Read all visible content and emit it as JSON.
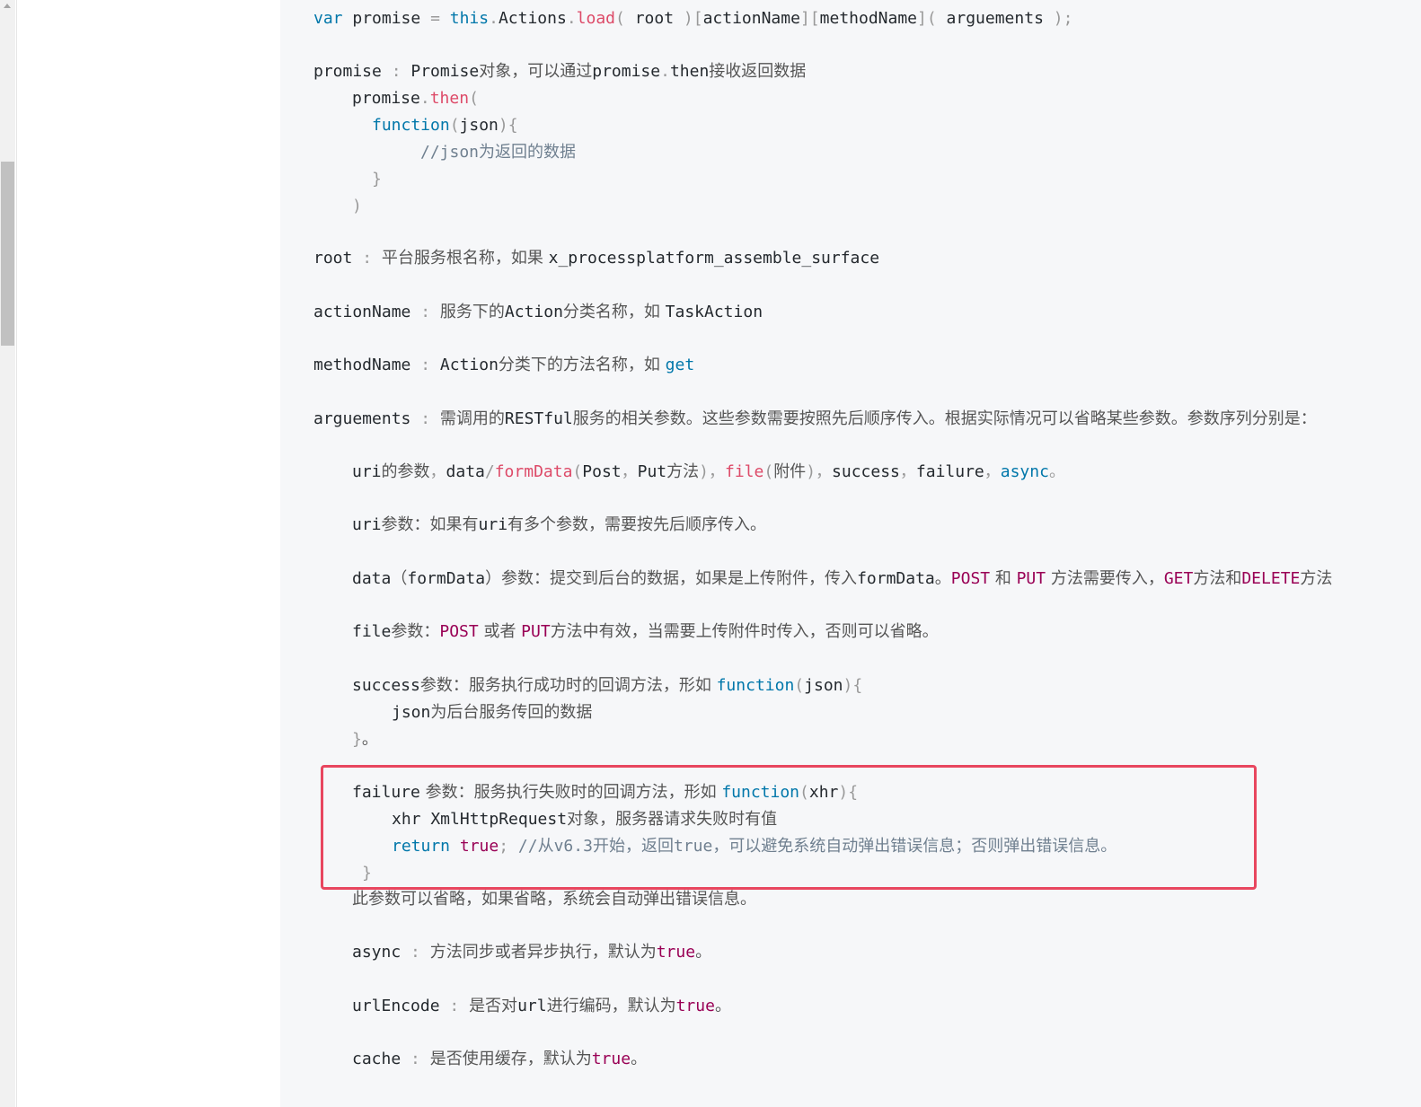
{
  "code": {
    "l01": [
      "var",
      " promise ",
      "=",
      " ",
      "this",
      ".",
      "Actions",
      ".",
      "load",
      "(",
      " root ",
      ")[",
      "actionName",
      "][",
      "methodName",
      "](",
      " arguements ",
      ");"
    ],
    "l02": [
      "promise",
      " : ",
      "Promise",
      "对象，可以通过",
      "promise",
      ".",
      "then",
      "接收返回数据"
    ],
    "l03": [
      "promise",
      ".",
      "then",
      "("
    ],
    "l04": [
      "function",
      "(",
      "json",
      "){"
    ],
    "l05": [
      "//json",
      "为返回的数据"
    ],
    "l06": "}",
    "l07": ")",
    "l08": [
      "root",
      " : ",
      "平台服务根名称，如果 ",
      "x_processplatform_assemble_surface"
    ],
    "l09": [
      "actionName",
      " : ",
      "服务下的",
      "Action",
      "分类名称，如 ",
      "TaskAction"
    ],
    "l10": [
      "methodName",
      " : ",
      "Action",
      "分类下的方法名称，如 ",
      "get"
    ],
    "l11": [
      "arguements",
      " : ",
      "需调用的",
      "RESTful",
      "服务的相关参数。这些参数需要按照先后顺序传入。根据实际情况可以省略某些参数。参数序列分别是："
    ],
    "l12": [
      "uri",
      "的参数",
      "，",
      "data",
      "/",
      "formData",
      "(",
      "Post",
      "，",
      "Put",
      "方法",
      ")，",
      "file",
      "(",
      "附件",
      ")，",
      "success",
      "，",
      "failure",
      "，",
      "async",
      "。"
    ],
    "l13": [
      "uri",
      "参数：如果有",
      "uri",
      "有多个参数，需要按先后顺序传入。"
    ],
    "l14": [
      "data",
      "（",
      "formData",
      "）参数：提交到后台的数据，如果是上传附件，传入",
      "formData",
      "。",
      "POST",
      " 和 ",
      "PUT",
      " 方法需要传入，",
      "GET",
      "方法和",
      "DELETE",
      "方法"
    ],
    "l15": [
      "file",
      "参数：",
      "POST",
      " 或者 ",
      "PUT",
      "方法中有效，当需要上传附件时传入，否则可以省略。"
    ],
    "l16": [
      "success",
      "参数：服务执行成功时的回调方法，形如 ",
      "function",
      "(",
      "json",
      "){"
    ],
    "l17": [
      "json",
      "为后台服务传回的数据"
    ],
    "l18": [
      "}",
      "。"
    ],
    "l19": [
      "failure",
      " 参数：服务执行失败时的回调方法，形如 ",
      "function",
      "(",
      "xhr",
      "){"
    ],
    "l20": [
      "xhr XmlHttpRequest",
      "对象，服务器请求失败时有值"
    ],
    "l21": [
      "return",
      " ",
      "true",
      ";",
      " //",
      "从",
      "v6.3",
      "开始，返回",
      "true",
      "，可以避免系统自动弹出错误信息；否则弹出错误信息。"
    ],
    "l22": "}",
    "l23": "此参数可以省略，如果省略，系统会自动弹出错误信息。",
    "l24": [
      "async",
      " : ",
      "方法同步或者异步执行，默认为",
      "true",
      "。"
    ],
    "l25": [
      "urlEncode",
      " : ",
      "是否对",
      "url",
      "进行编码，默认为",
      "true",
      "。"
    ],
    "l26": [
      "cache",
      " : ",
      "是否使用缓存，默认为",
      "true",
      "。"
    ]
  },
  "colors": {
    "keyword": "#0077aa",
    "function_name": "#dd4a68",
    "string_token": "#990055",
    "comment": "#708090",
    "highlight_border": "#e8465f"
  }
}
